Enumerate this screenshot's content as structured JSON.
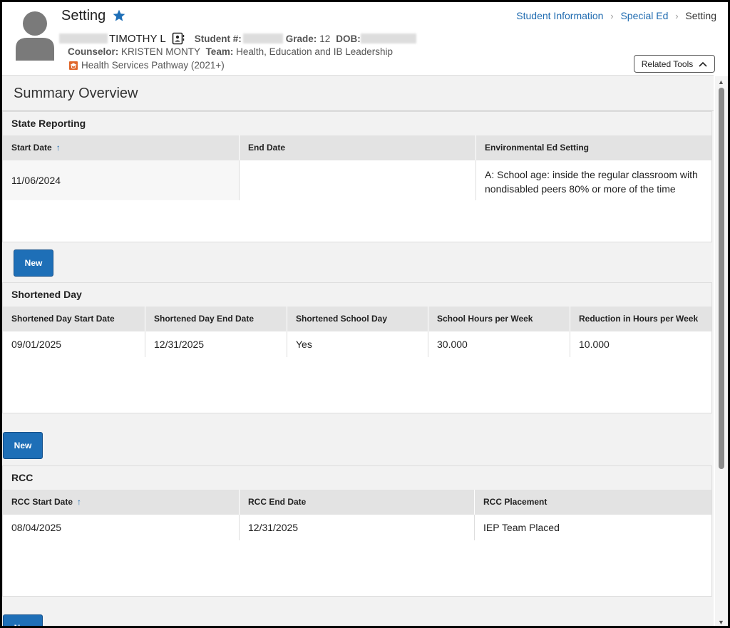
{
  "header": {
    "title": "Setting",
    "breadcrumb": [
      "Student Information",
      "Special Ed"
    ],
    "breadcrumb_current": "Setting",
    "student_name": "TIMOTHY L",
    "student_num_label": "Student #:",
    "grade_label": "Grade:",
    "grade_value": "12",
    "dob_label": "DOB:",
    "counselor_label": "Counselor:",
    "counselor_value": "KRISTEN MONTY",
    "team_label": "Team:",
    "team_value": "Health, Education and IB Leadership",
    "pathway": "Health Services Pathway (2021+)",
    "related_tools": "Related Tools"
  },
  "summary": {
    "title": "Summary Overview"
  },
  "state_reporting": {
    "title": "State Reporting",
    "columns": [
      "Start Date",
      "End Date",
      "Environmental Ed Setting"
    ],
    "rows": [
      [
        "11/06/2024",
        "",
        "A: School age: inside the regular classroom with nondisabled peers 80% or more of the time"
      ]
    ],
    "new_label": "New"
  },
  "shortened_day": {
    "title": "Shortened Day",
    "columns": [
      "Shortened Day Start Date",
      "Shortened Day End Date",
      "Shortened School Day",
      "School Hours per Week",
      "Reduction in Hours per Week"
    ],
    "rows": [
      [
        "09/01/2025",
        "12/31/2025",
        "Yes",
        "30.000",
        "10.000"
      ]
    ],
    "new_label": "New"
  },
  "rcc": {
    "title": "RCC",
    "columns": [
      "RCC Start Date",
      "RCC End Date",
      "RCC Placement"
    ],
    "rows": [
      [
        "08/04/2025",
        "12/31/2025",
        "IEP Team Placed"
      ]
    ],
    "new_label": "New"
  },
  "colors": {
    "accent": "#1e6fb7",
    "link": "#1f6bb0",
    "pathway_icon": "#e0662a"
  }
}
